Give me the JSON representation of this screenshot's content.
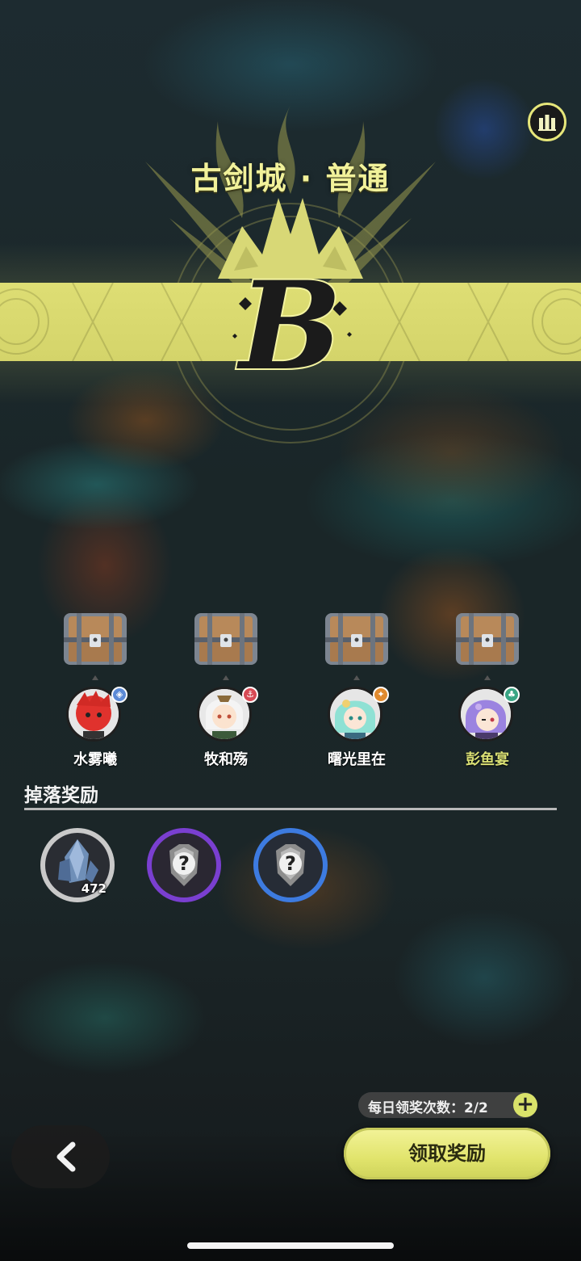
{
  "stage": {
    "title": "古剑城 · 普通",
    "grade": "B"
  },
  "colors": {
    "accent": "#dede74",
    "accent_text": "#f1f19a",
    "highlight_name": "#d9df74"
  },
  "party": [
    {
      "name": "水雾曦",
      "element": "water-icon",
      "element_color": "#5b8ad6",
      "highlight": false
    },
    {
      "name": "牧和殇",
      "element": "anchor-icon",
      "element_color": "#d74a55",
      "highlight": false
    },
    {
      "name": "曙光里在",
      "element": "sun-icon",
      "element_color": "#e08a2e",
      "highlight": false
    },
    {
      "name": "彭鱼宴",
      "element": "leaf-icon",
      "element_color": "#3aa584",
      "highlight": true
    }
  ],
  "rewards_section": {
    "title": "掉落奖励",
    "items": [
      {
        "icon": "crystal-icon",
        "count": "472",
        "rarity": "white"
      },
      {
        "icon": "mystery-armor-icon",
        "count": "",
        "rarity": "purple"
      },
      {
        "icon": "mystery-armor-icon",
        "count": "",
        "rarity": "blue"
      }
    ]
  },
  "daily_claims": {
    "label": "每日领奖次数：2/2",
    "plus": "+"
  },
  "buttons": {
    "back": "back-arrow-icon",
    "claim": "领取奖励"
  }
}
